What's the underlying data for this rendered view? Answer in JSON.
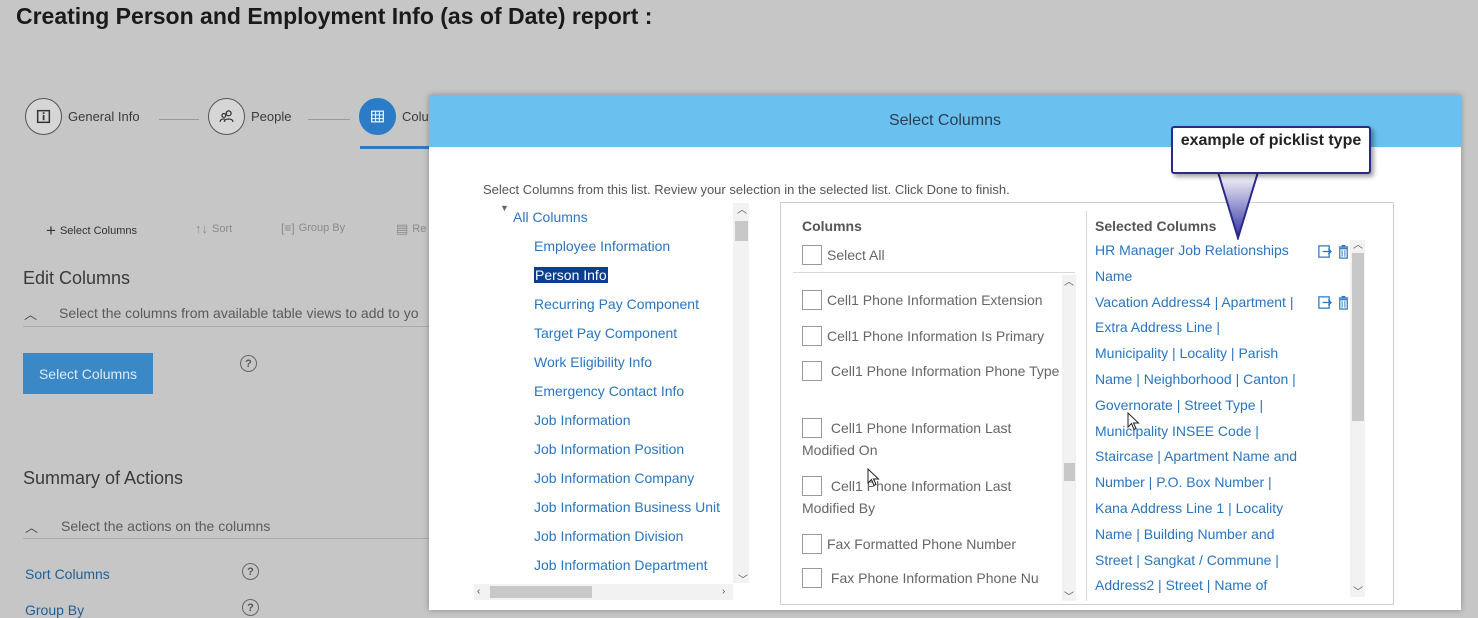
{
  "page_title": "Creating Person and Employment Info (as of Date) report :",
  "steps": [
    {
      "label": "General Info",
      "icon": "info-icon"
    },
    {
      "label": "People",
      "icon": "people-icon"
    },
    {
      "label": "Colu",
      "icon": "table-icon"
    }
  ],
  "toolbar": {
    "select_columns": "Select Columns",
    "sort": "Sort",
    "group_by": "Group By",
    "re": "Re"
  },
  "edit_columns": {
    "title": "Edit Columns",
    "subtitle": "Select the columns from available table views to add to yo",
    "button": "Select Columns"
  },
  "summary": {
    "title": "Summary of Actions",
    "subtitle": "Select the actions on the columns",
    "sort_columns": "Sort Columns",
    "group_by": "Group By"
  },
  "modal": {
    "title": "Select Columns",
    "instructions": "Select Columns from this list. Review your selection in the selected list. Click Done to finish.",
    "tree": {
      "root": "All Columns",
      "items": [
        "Employee Information",
        "Person Info",
        "Recurring Pay Component",
        "Target Pay Component",
        "Work Eligibility Info",
        "Emergency Contact Info",
        "Job Information",
        "Job Information Position",
        "Job Information Company",
        "Job Information Business Unit",
        "Job Information Division",
        "Job Information Department"
      ],
      "selected_index": 1
    },
    "columns": {
      "header": "Columns",
      "select_all": "Select All",
      "items": [
        "Cell1 Phone Information Extension",
        "Cell1 Phone Information Is Primary",
        "Cell1 Phone Information Phone Type",
        "Cell1 Phone Information Last Modified On",
        "Cell1 Phone Information Last Modified By",
        "Fax Formatted Phone Number",
        "Fax Phone Information Phone Nu"
      ]
    },
    "selected": {
      "header": "Selected Columns",
      "lines": [
        "HR Manager Job Relationships",
        "Name",
        "Vacation Address4 | Apartment |",
        "Extra Address Line |",
        "Municipality | Locality | Parish",
        "Name | Neighborhood | Canton |",
        "Governorate | Street Type |",
        "Municipality INSEE Code |",
        "Staircase | Apartment Name and",
        "Number | P.O. Box Number |",
        "Kana Address Line 1 | Locality",
        "Name | Building Number and",
        "Street | Sangkat / Commune |",
        "Address2 | Street | Name of"
      ]
    }
  },
  "callout": {
    "text": "example of picklist type"
  },
  "colors": {
    "modal_header": "#6ac0ef",
    "link": "#2a75c0",
    "selected_item": "#0a3f8f",
    "primary_button": "#3b88c7"
  }
}
